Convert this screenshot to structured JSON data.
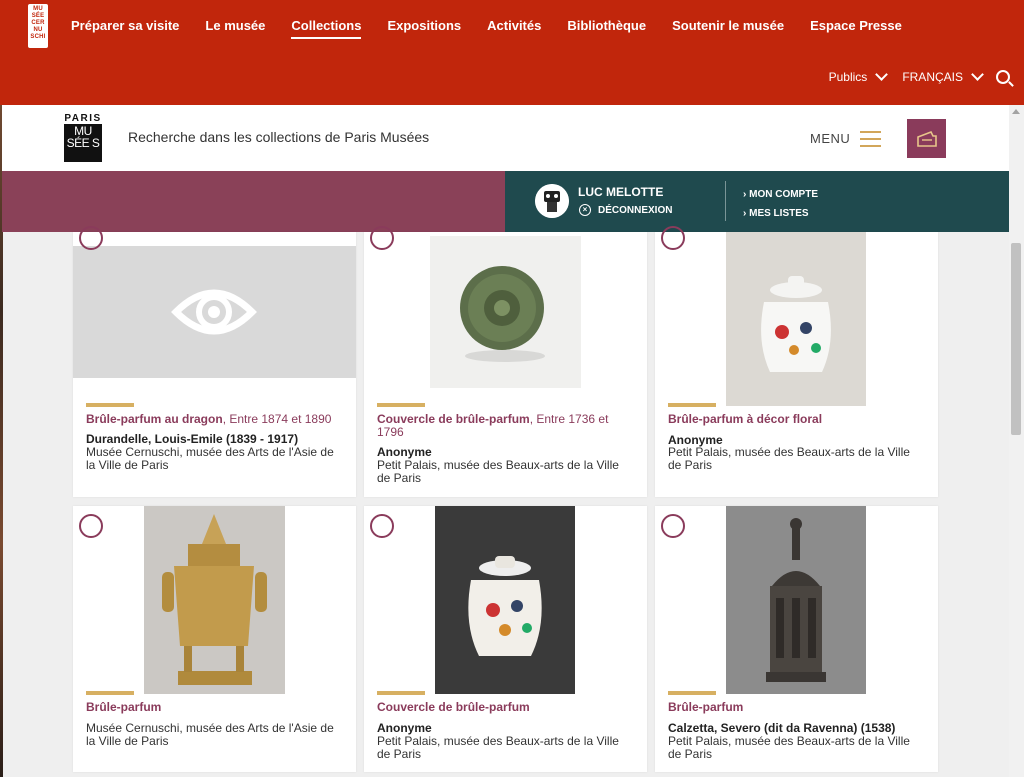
{
  "logo_text": "MU SÉE CER NU SCHI",
  "nav": {
    "items": [
      "Préparer sa visite",
      "Le musée",
      "Collections",
      "Expositions",
      "Activités",
      "Bibliothèque",
      "Soutenir le musée",
      "Espace Presse"
    ],
    "active": "Collections"
  },
  "subnav": {
    "publics": "Publics",
    "language": "FRANÇAIS"
  },
  "header": {
    "logo_top": "PARIS",
    "logo_box": "MU SÉE S",
    "title": "Recherche dans les collections de Paris Musées",
    "menu": "MENU"
  },
  "user": {
    "name": "LUC MELOTTE",
    "logout": "DÉCONNEXION",
    "account": "MON COMPTE",
    "lists": "MES LISTES"
  },
  "colors": {
    "topbar": "#c1260c",
    "accent": "#8a3b5b",
    "userbar": "#1f4a4e",
    "gold": "#d7b062"
  },
  "cards": [
    {
      "title": "Brûle-parfum au dragon",
      "date": ", Entre 1874 et 1890",
      "artist": "Durandelle, Louis-Emile (1839 - 1917)",
      "museum": "Musée Cernuschi, musée des Arts de l'Asie de la Ville de Paris",
      "image": "eye-placeholder"
    },
    {
      "title": "Couvercle de brûle-parfum",
      "date": ", Entre 1736 et 1796",
      "artist": "Anonyme",
      "museum": "Petit Palais, musée des Beaux-arts de la Ville de Paris",
      "image": "jade-lid"
    },
    {
      "title": "Brûle-parfum à décor floral",
      "date": "",
      "artist": "Anonyme",
      "museum": "Petit Palais, musée des Beaux-arts de la Ville de Paris",
      "image": "porcelain-jar"
    },
    {
      "title": "Brûle-parfum",
      "date": "",
      "artist": "",
      "museum": "Musée Cernuschi, musée des Arts de l'Asie de la Ville de Paris",
      "image": "bronze-censer"
    },
    {
      "title": "Couvercle de brûle-parfum",
      "date": "",
      "artist": "Anonyme",
      "museum": "Petit Palais, musée des Beaux-arts de la Ville de Paris",
      "image": "porcelain-jar-dark"
    },
    {
      "title": "Brûle-parfum",
      "date": "",
      "artist": "Calzetta, Severo (dit da Ravenna) (1538)",
      "museum": "Petit Palais, musée des Beaux-arts de la Ville de Paris",
      "image": "bronze-tower"
    }
  ]
}
